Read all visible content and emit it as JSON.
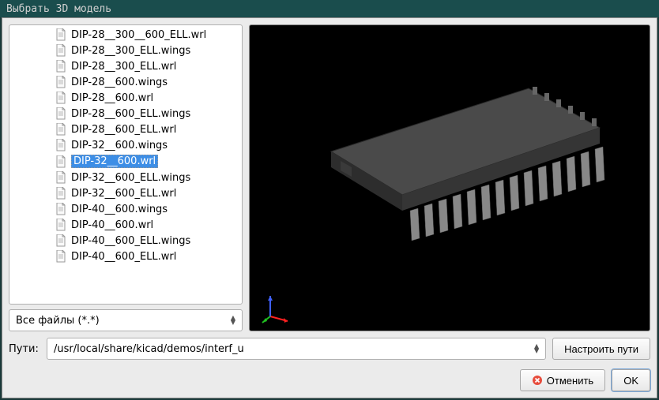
{
  "window": {
    "title": "Выбрать 3D модель"
  },
  "files": [
    {
      "name": "DIP-28__300__600_ELL.wrl",
      "selected": false
    },
    {
      "name": "DIP-28__300_ELL.wings",
      "selected": false
    },
    {
      "name": "DIP-28__300_ELL.wrl",
      "selected": false
    },
    {
      "name": "DIP-28__600.wings",
      "selected": false
    },
    {
      "name": "DIP-28__600.wrl",
      "selected": false
    },
    {
      "name": "DIP-28__600_ELL.wings",
      "selected": false
    },
    {
      "name": "DIP-28__600_ELL.wrl",
      "selected": false
    },
    {
      "name": "DIP-32__600.wings",
      "selected": false
    },
    {
      "name": "DIP-32__600.wrl",
      "selected": true
    },
    {
      "name": "DIP-32__600_ELL.wings",
      "selected": false
    },
    {
      "name": "DIP-32__600_ELL.wrl",
      "selected": false
    },
    {
      "name": "DIP-40__600.wings",
      "selected": false
    },
    {
      "name": "DIP-40__600.wrl",
      "selected": false
    },
    {
      "name": "DIP-40__600_ELL.wings",
      "selected": false
    },
    {
      "name": "DIP-40__600_ELL.wrl",
      "selected": false
    }
  ],
  "filter": {
    "selected": "Все файлы (*.*)"
  },
  "path": {
    "label": "Пути:",
    "value": "/usr/local/share/kicad/demos/interf_u",
    "configure_button": "Настроить пути"
  },
  "buttons": {
    "cancel": "Отменить",
    "ok": "OK"
  },
  "colors": {
    "selection": "#3d8ee6",
    "axis_x": "#ff2020",
    "axis_y": "#20c020",
    "axis_z": "#4060ff"
  }
}
